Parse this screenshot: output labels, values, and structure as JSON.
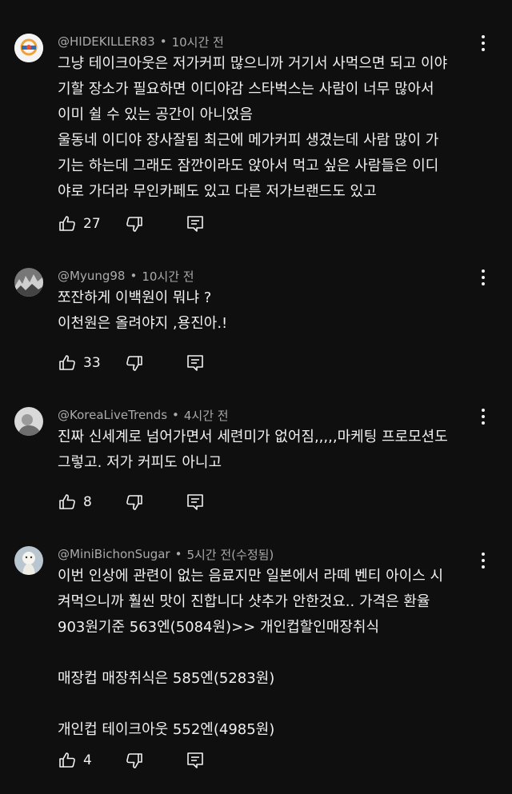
{
  "comments": [
    {
      "author": "@HIDEKILLER83",
      "time": "10시간 전",
      "text": "그냥 테이크아웃은 저가커피 많으니까 거기서 사먹으면 되고 이야\n기할 장소가 필요하면 이디야감 스타벅스는 사람이 너무 많아서\n이미 쉴 수 있는 공간이 아니었음\n울동네 이디야 장사잘됨 최근에 메가커피 생겼는데 사람 많이 가\n기는 하는데 그래도 잠깐이라도 앉아서 먹고 싶은 사람들은 이디\n야로 가더라 무인카페도 있고 다른 저가브랜드도 있고",
      "likes": "27"
    },
    {
      "author": "@Myung98",
      "time": "10시간 전",
      "text": "쪼잔하게 이백원이 뭐냐 ?\n이천원은 올려야지 ,용진아.!",
      "likes": "33"
    },
    {
      "author": "@KoreaLiveTrends",
      "time": "4시간 전",
      "text": "진짜 신세계로 넘어가면서 세련미가 없어짐,,,,,마케팅 프로모션도\n그렇고. 저가 커피도 아니고",
      "likes": "8"
    },
    {
      "author": "@MiniBichonSugar",
      "time": "5시간 전(수정됨)",
      "text": "이번 인상에 관련이 없는 음료지만 일본에서 라떼 벤티 아이스 시\n켜먹으니까 훨씬 맛이 진합니다 샷추가 안한것요..  가격은 환율\n903원기준 563엔(5084원)>> 개인컵할인매장취식\n\n매장컵 매장취식은 585엔(5283원)\n\n개인컵 테이크아웃 552엔(4985원)",
      "likes": "4"
    }
  ],
  "separator": "•",
  "icons": {
    "like": "thumbs-up-icon",
    "dislike": "thumbs-down-icon",
    "reply": "reply-icon",
    "menu": "more-vertical-icon"
  },
  "colors": {
    "background": "#0f0f0f",
    "text": "#f1f1f1",
    "meta": "#aaaaaa"
  }
}
